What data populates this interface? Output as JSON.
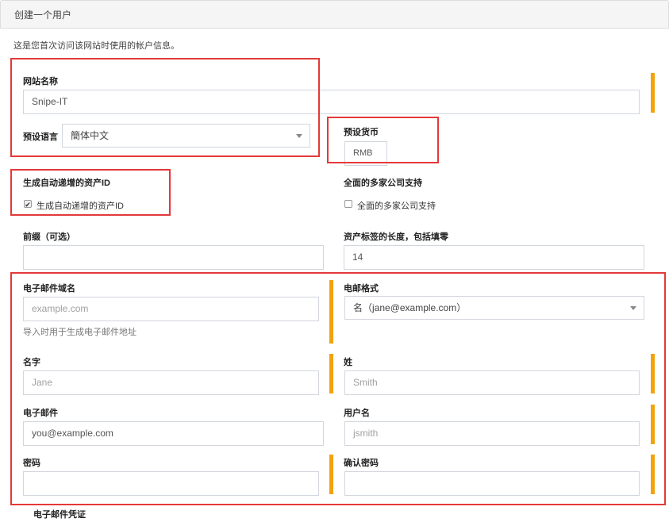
{
  "panel": {
    "title": "创建一个用户"
  },
  "intro": "这是您首次访问该网站时使用的帐户信息。",
  "site_name": {
    "label": "网站名称",
    "value": "Snipe-IT"
  },
  "default_language": {
    "label": "预设语言",
    "value": "簡体中文"
  },
  "default_currency": {
    "label": "预设货币",
    "value": "RMB"
  },
  "auto_increment": {
    "label": "生成自动递增的资产ID",
    "checkbox_label": "生成自动递增的资产ID",
    "checked": true
  },
  "full_multiple_companies": {
    "label": "全面的多家公司支持",
    "checkbox_label": "全面的多家公司支持",
    "checked": false
  },
  "prefix": {
    "label": "前缀（可选）",
    "value": ""
  },
  "asset_tag_length": {
    "label": "资产标签的长度，包括填零",
    "value": "14"
  },
  "email_domain": {
    "label": "电子邮件域名",
    "placeholder": "example.com",
    "help": "导入时用于生成电子邮件地址"
  },
  "email_format": {
    "label": "电邮格式",
    "value": "名（jane@example.com）"
  },
  "first_name": {
    "label": "名字",
    "placeholder": "Jane"
  },
  "last_name": {
    "label": "姓",
    "placeholder": "Smith"
  },
  "email": {
    "label": "电子邮件",
    "value": "you@example.com"
  },
  "username": {
    "label": "用户名",
    "placeholder": "jsmith"
  },
  "password": {
    "label": "密码",
    "value": ""
  },
  "confirm_password": {
    "label": "确认密码",
    "value": ""
  },
  "email_credentials": {
    "label": "电子邮件凭证"
  },
  "colors": {
    "annotation_red": "#e3393a",
    "required_bar": "#f0a30a"
  },
  "icons": {
    "select_caret": "caret-down-icon",
    "checkbox": "checkbox-icon"
  }
}
